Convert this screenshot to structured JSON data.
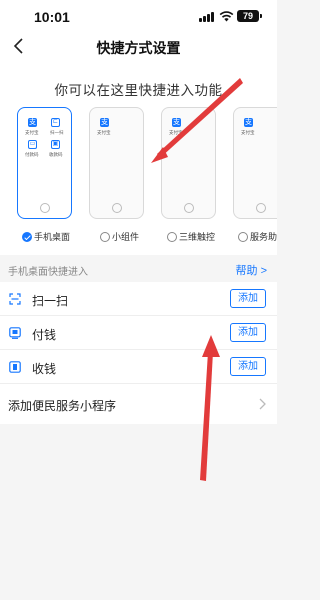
{
  "status": {
    "time": "10:01",
    "battery": "79"
  },
  "nav": {
    "title": "快捷方式设置"
  },
  "hint": "你可以在这里快捷进入功能",
  "preview_apps": {
    "alipay": "支付宝",
    "scan": "扫一扫",
    "pay": "付款码",
    "collect": "收款码",
    "alipay_icon_char": "支"
  },
  "options": [
    {
      "label": "手机桌面",
      "selected": true
    },
    {
      "label": "小组件",
      "selected": false
    },
    {
      "label": "三维触控",
      "selected": false
    },
    {
      "label": "服务助手",
      "selected": false
    }
  ],
  "section": {
    "title": "手机桌面快捷进入",
    "help": "帮助 >"
  },
  "rows": [
    {
      "label": "扫一扫",
      "action": "添加",
      "icon": "scan-icon"
    },
    {
      "label": "付钱",
      "action": "添加",
      "icon": "pay-icon"
    },
    {
      "label": "收钱",
      "action": "添加",
      "icon": "receive-icon"
    }
  ],
  "mini_program_row": {
    "label": "添加便民服务小程序"
  },
  "colors": {
    "accent": "#1677ff",
    "annotation_arrow": "#e23b3b"
  }
}
